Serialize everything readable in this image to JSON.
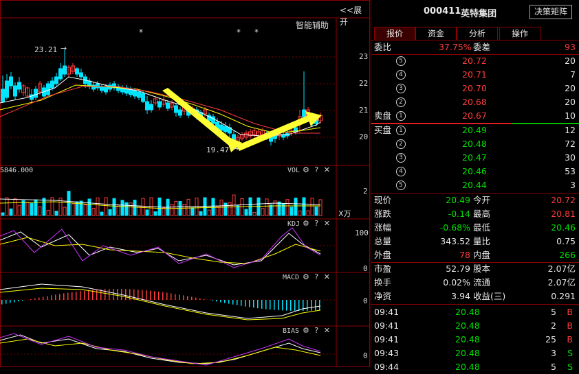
{
  "chart": {
    "expand_label": "<<展开",
    "assist_label": "智能辅助",
    "high_marker": "23.21",
    "low_marker": "19.47",
    "price_axis": [
      "23",
      "22",
      "21",
      "20"
    ],
    "vol_value_label": "5846.000",
    "vol_label": "VOL",
    "vol_axis": [
      "2"
    ],
    "vol_unit": "X万",
    "kdj_label": "KDJ",
    "kdj_axis": [
      "100",
      "0"
    ],
    "macd_label": "MACD",
    "macd_axis": [
      "0"
    ],
    "bias_label": "BIAS",
    "bias_axis": [
      "0"
    ],
    "tool_glyphs": {
      "gear": "⚙",
      "help": "?",
      "close": "✕"
    },
    "star_glyph": "*",
    "colors": {
      "up": "#ff3c3c",
      "down": "#00e5ff",
      "ma1": "#ffffff",
      "ma2": "#ffff00",
      "ma3": "#ff3c3c",
      "kdj_j": "#cc33ff",
      "arrow": "#ffff33"
    }
  },
  "quote": {
    "code": "000411",
    "name": "英特集团",
    "decision_button": "决策矩阵",
    "tabs": [
      "报价",
      "资金",
      "分析",
      "操作"
    ],
    "ratio": {
      "label": "委比",
      "value": "37.75%",
      "diff_label": "委差",
      "diff_value": "93"
    },
    "asks": [
      {
        "label": "5",
        "price": "20.72",
        "volume": "20"
      },
      {
        "label": "4",
        "price": "20.71",
        "volume": "7"
      },
      {
        "label": "3",
        "price": "20.70",
        "volume": "20"
      },
      {
        "label": "2",
        "price": "20.68",
        "volume": "20"
      },
      {
        "label": "1",
        "price": "20.67",
        "volume": "10"
      }
    ],
    "sell_label": "卖盘",
    "buy_label": "买盘",
    "bids": [
      {
        "label": "1",
        "price": "20.49",
        "volume": "12"
      },
      {
        "label": "2",
        "price": "20.48",
        "volume": "72"
      },
      {
        "label": "3",
        "price": "20.47",
        "volume": "30"
      },
      {
        "label": "4",
        "price": "20.46",
        "volume": "53"
      },
      {
        "label": "5",
        "price": "20.44",
        "volume": "3"
      }
    ],
    "stats": [
      {
        "l1": "现价",
        "v1": "20.49",
        "c1": "green",
        "l2": "今开",
        "v2": "20.72",
        "c2": "red"
      },
      {
        "l1": "涨跌",
        "v1": "-0.14",
        "c1": "green",
        "l2": "最高",
        "v2": "20.81",
        "c2": "red"
      },
      {
        "l1": "涨幅",
        "v1": "-0.68%",
        "c1": "green",
        "l2": "最低",
        "v2": "20.46",
        "c2": "green"
      },
      {
        "l1": "总量",
        "v1": "343.52",
        "c1": "white",
        "l2": "量比",
        "v2": "0.75",
        "c2": "white"
      },
      {
        "l1": "外盘",
        "v1": "78",
        "c1": "red",
        "l2": "内盘",
        "v2": "266",
        "c2": "green"
      }
    ],
    "fundamentals": [
      {
        "l1": "市盈",
        "v1": "52.79",
        "l2": "股本",
        "v2": "2.07亿"
      },
      {
        "l1": "换手",
        "v1": "0.02%",
        "l2": "流通",
        "v2": "2.07亿"
      },
      {
        "l1": "净资",
        "v1": "3.94",
        "l2": "收益(三)",
        "v2": "0.291"
      }
    ],
    "ticks": [
      {
        "time": "09:41",
        "price": "20.48",
        "volume": "5",
        "side": "B"
      },
      {
        "time": "09:41",
        "price": "20.48",
        "volume": "2",
        "side": "B"
      },
      {
        "time": "09:41",
        "price": "20.48",
        "volume": "25",
        "side": "B"
      },
      {
        "time": "09:43",
        "price": "20.48",
        "volume": "3",
        "side": "S"
      },
      {
        "time": "09:44",
        "price": "20.48",
        "volume": "5",
        "side": "S"
      }
    ]
  }
}
